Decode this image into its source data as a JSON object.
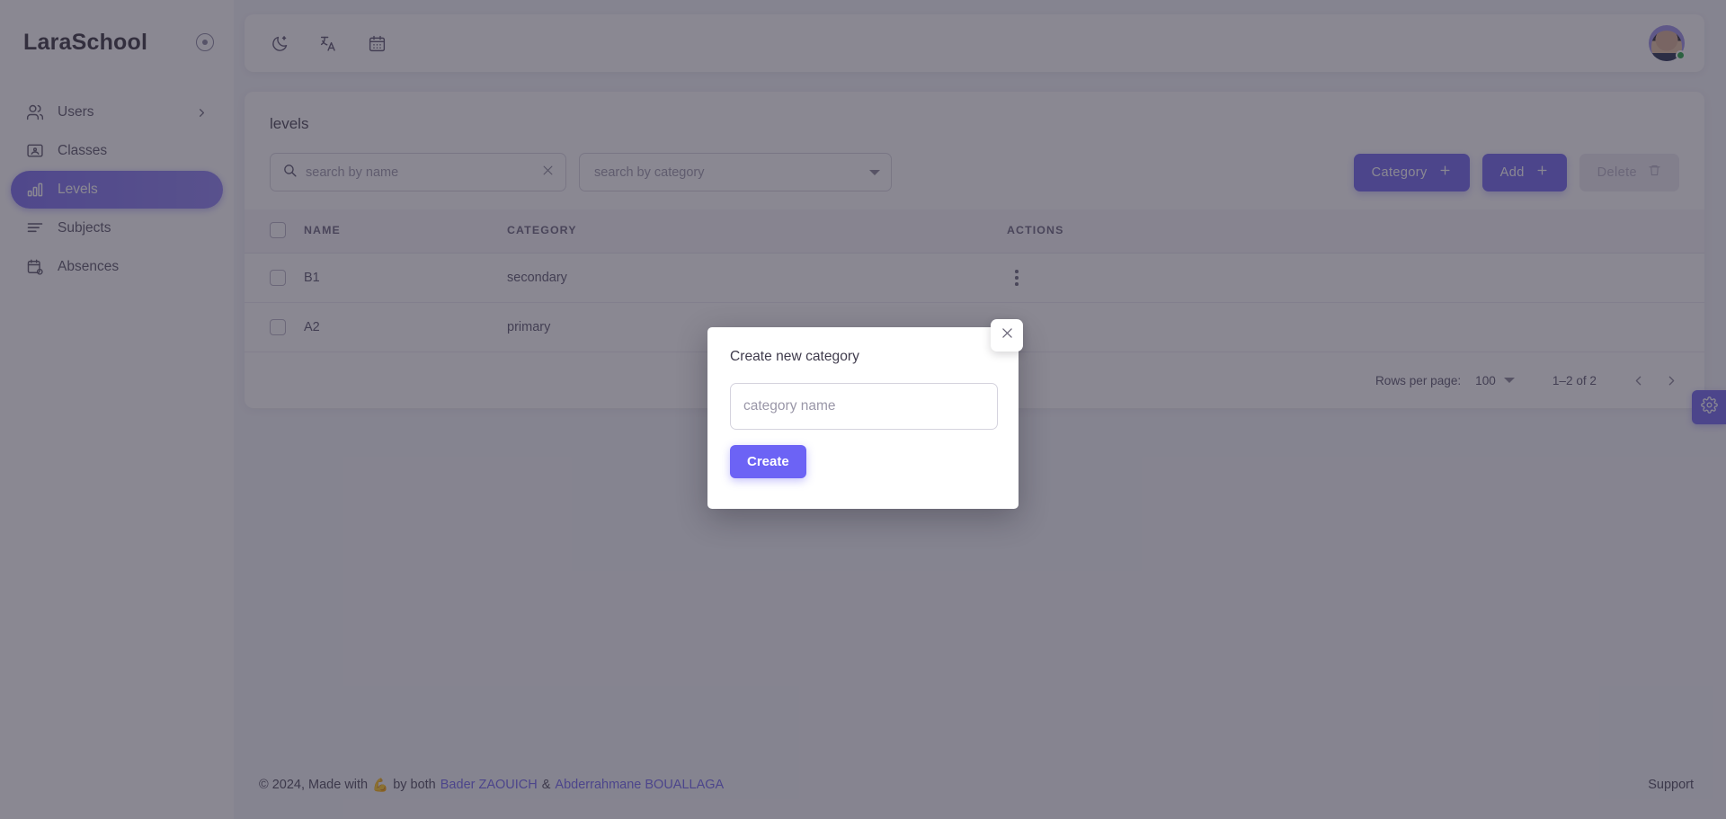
{
  "brand": {
    "title": "LaraSchool",
    "collapse_icon": "circle-dot-icon"
  },
  "sidebar": {
    "items": [
      {
        "label": "Users",
        "icon": "users-icon",
        "active": false,
        "has_chevron": true
      },
      {
        "label": "Classes",
        "icon": "classroom-icon",
        "active": false,
        "has_chevron": false
      },
      {
        "label": "Levels",
        "icon": "bar-chart-icon",
        "active": true,
        "has_chevron": false
      },
      {
        "label": "Subjects",
        "icon": "list-icon",
        "active": false,
        "has_chevron": false
      },
      {
        "label": "Absences",
        "icon": "calendar-clock-icon",
        "active": false,
        "has_chevron": false
      }
    ]
  },
  "appbar": {
    "icons": [
      {
        "name": "moon-icon"
      },
      {
        "name": "translate-icon"
      },
      {
        "name": "calendar-icon"
      }
    ],
    "avatar": {
      "name": "user-avatar",
      "status": "online",
      "status_color": "#28a745"
    }
  },
  "page": {
    "title": "levels"
  },
  "toolbar": {
    "search_placeholder": "search by name",
    "search_value": "",
    "category_placeholder": "search by category",
    "category_value": "",
    "category_button": "Category",
    "add_button": "Add",
    "delete_button": "Delete"
  },
  "table": {
    "columns": [
      "NAME",
      "CATEGORY",
      "ACTIONS"
    ],
    "rows": [
      {
        "name": "B1",
        "category": "secondary",
        "checked": false
      },
      {
        "name": "A2",
        "category": "primary",
        "checked": false
      }
    ]
  },
  "pagination": {
    "rows_per_page_label": "Rows per page:",
    "rows_per_page_value": "100",
    "range": "1–2 of 2",
    "prev_icon": "chevron-left-icon",
    "next_icon": "chevron-right-icon"
  },
  "modal": {
    "title": "Create new category",
    "input_placeholder": "category name",
    "input_value": "",
    "create_button": "Create",
    "close_icon": "close-icon"
  },
  "footer": {
    "copy_prefix": "© 2024, Made with",
    "emoji": "💪",
    "copy_mid": "by both",
    "author_one": "Bader ZAOUICH",
    "author_sep": "&",
    "author_two": "Abderrahmane BOUALLAGA",
    "support": "Support"
  },
  "settings_tab": {
    "icon": "gear-icon"
  },
  "colors": {
    "accent": "#7367f0",
    "modal_accent": "#6c63f5",
    "page_bg": "#f4f5fa",
    "card_bg": "#ffffff",
    "scrim": "rgba(47,43,61,0.56)",
    "status_online": "#28a745"
  }
}
